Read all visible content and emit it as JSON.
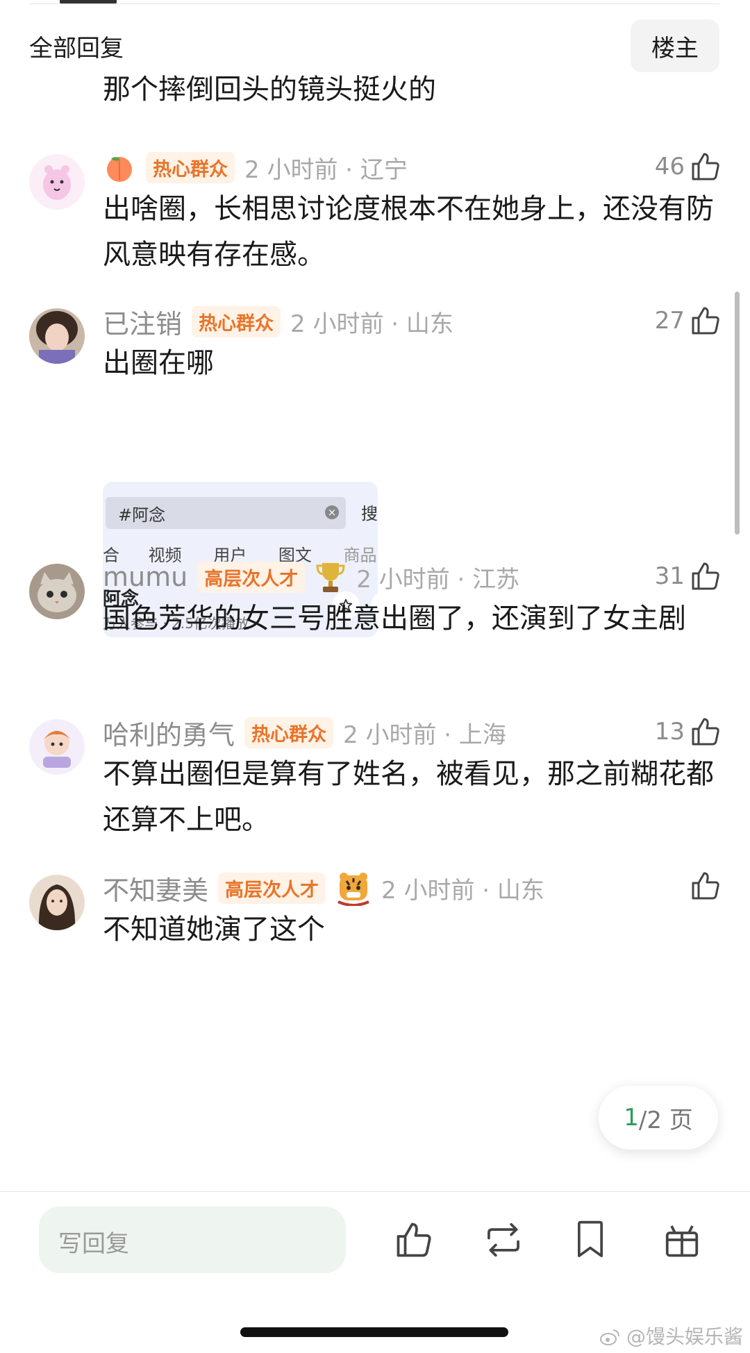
{
  "section_title": "全部回复",
  "owner_button": "楼主",
  "top_text": "那个摔倒回头的镜头挺火的",
  "comments": [
    {
      "username": "",
      "badge_icon": "peach-emoji",
      "tag": "热心群众",
      "time": "2 小时前 · 辽宁",
      "likes": "46",
      "text": "出啥圈，长相思讨论度根本不在她身上，还没有防风意映有存在感。"
    },
    {
      "username": "已注销",
      "tag": "热心群众",
      "time": "2 小时前 · 山东",
      "likes": "27",
      "text": "出圈在哪"
    },
    {
      "username": "mumu",
      "tag": "高层次人才",
      "badge_icon": "trophy-emoji",
      "time": "2 小时前 · 江苏",
      "likes": "31",
      "text": "国色芳华的女三号胜意出圈了，还演到了女主剧"
    },
    {
      "username": "哈利的勇气",
      "tag": "热心群众",
      "time": "2 小时前 · 上海",
      "likes": "13",
      "text": "不算出圈但是算有了姓名，被看见，那之前糊花都还算不上吧。"
    },
    {
      "username": "不知妻美",
      "tag": "高层次人才",
      "badge_icon": "tiger-emoji",
      "time": "2 小时前 · 山东",
      "text": "不知道她演了这个"
    }
  ],
  "thumbnail": {
    "query": "#阿念",
    "search_button": "搜",
    "tabs": [
      "合",
      "视频",
      "用户",
      "图文",
      "商品"
    ],
    "title": "阿念",
    "subtitle": "万人参与 · 2.5亿次播放"
  },
  "pager": {
    "current": "1",
    "rest": "/2 页"
  },
  "reply_placeholder": "写回复",
  "watermark": "@馒头娱乐酱",
  "icons": [
    "thumb-up-icon",
    "repost-icon",
    "bookmark-icon",
    "gift-icon"
  ],
  "colors": {
    "tag_text": "#e8742a",
    "tag_bg": "#fff2e6",
    "accent_green": "#2c9a5b",
    "reply_bg": "#eef4ef"
  }
}
